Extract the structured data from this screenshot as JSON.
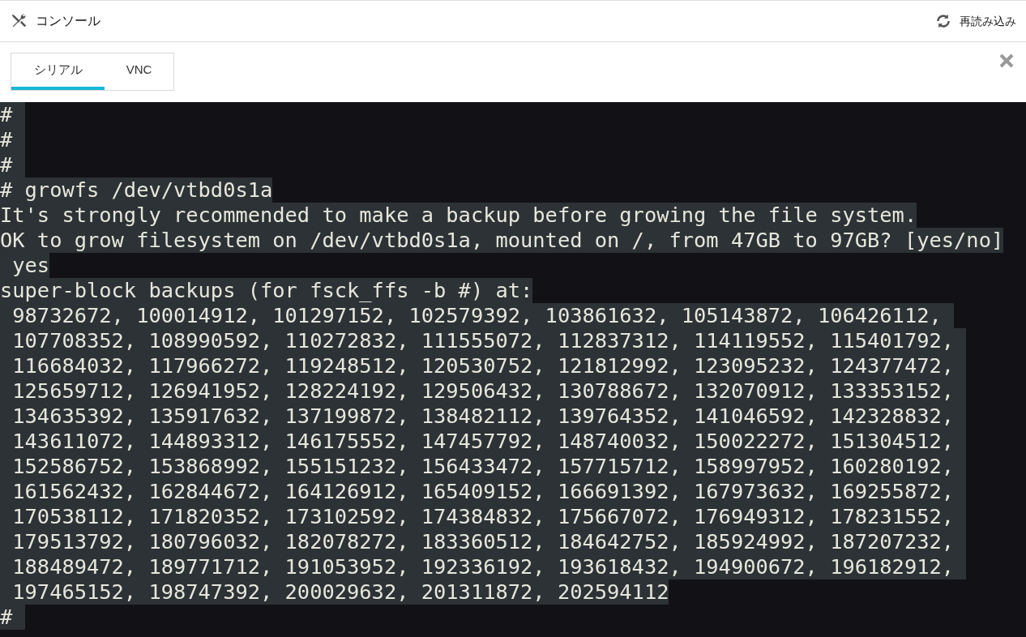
{
  "header": {
    "title": "コンソール",
    "reload_button": "再読み込み"
  },
  "tabs": [
    {
      "label": "シリアル",
      "selected": true
    },
    {
      "label": "VNC",
      "selected": false
    }
  ],
  "terminal": {
    "lines": [
      "# ",
      "# ",
      "# ",
      "# growfs /dev/vtbd0s1a",
      "It's strongly recommended to make a backup before growing the file system.",
      "OK to grow filesystem on /dev/vtbd0s1a, mounted on /, from 47GB to 97GB? [yes/no]",
      " yes",
      "super-block backups (for fsck_ffs -b #) at:",
      " 98732672, 100014912, 101297152, 102579392, 103861632, 105143872, 106426112, ",
      " 107708352, 108990592, 110272832, 111555072, 112837312, 114119552, 115401792, ",
      " 116684032, 117966272, 119248512, 120530752, 121812992, 123095232, 124377472, ",
      " 125659712, 126941952, 128224192, 129506432, 130788672, 132070912, 133353152, ",
      " 134635392, 135917632, 137199872, 138482112, 139764352, 141046592, 142328832, ",
      " 143611072, 144893312, 146175552, 147457792, 148740032, 150022272, 151304512, ",
      " 152586752, 153868992, 155151232, 156433472, 157715712, 158997952, 160280192, ",
      " 161562432, 162844672, 164126912, 165409152, 166691392, 167973632, 169255872, ",
      " 170538112, 171820352, 173102592, 174384832, 175667072, 176949312, 178231552, ",
      " 179513792, 180796032, 182078272, 183360512, 184642752, 185924992, 187207232, ",
      " 188489472, 189771712, 191053952, 192336192, 193618432, 194900672, 196182912, ",
      " 197465152, 198747392, 200029632, 201311872, 202594112",
      "# "
    ]
  }
}
